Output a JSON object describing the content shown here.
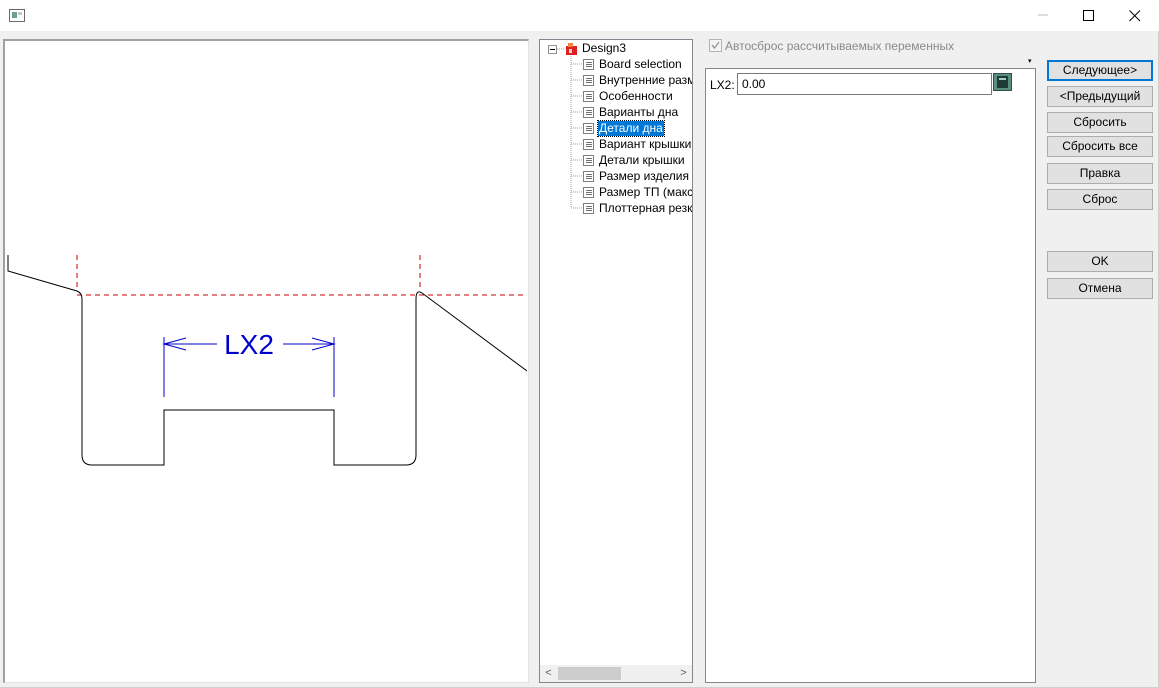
{
  "window": {
    "controls": {
      "minimize_icon": "minimize-icon",
      "maximize_icon": "maximize-icon",
      "close_icon": "close-icon"
    }
  },
  "preview": {
    "dimension_label": "LX2",
    "colors": {
      "outline": "#000000",
      "guide": "#cc0000",
      "dimension": "#0000cc"
    }
  },
  "tree": {
    "root": "Design3",
    "items": [
      {
        "label": "Board selection",
        "selected": false
      },
      {
        "label": "Внутренние разме",
        "selected": false
      },
      {
        "label": "Особенности",
        "selected": false
      },
      {
        "label": "Варианты дна",
        "selected": false
      },
      {
        "label": "Детали дна",
        "selected": true
      },
      {
        "label": "Вариант крышки",
        "selected": false
      },
      {
        "label": "Детали крышки",
        "selected": false
      },
      {
        "label": "Размер изделия",
        "selected": false
      },
      {
        "label": "Размер ТП (макс Г",
        "selected": false
      },
      {
        "label": "Плоттерная резка",
        "selected": false
      }
    ],
    "scroll_left": "<",
    "scroll_right": ">"
  },
  "options": {
    "auto_reset_label": "Автосброс рассчитываемых переменных",
    "auto_reset_checked": true,
    "dropdown_arrow": "▾"
  },
  "variables": [
    {
      "label": "LX2:",
      "value": "0.00"
    }
  ],
  "buttons": {
    "next": "Следующее>",
    "prev": "<Предыдущий",
    "reset": "Сбросить",
    "reset_all": "Сбросить все",
    "edit": "Правка",
    "clear": "Сброс",
    "ok": "OK",
    "cancel": "Отмена"
  },
  "accent_color": "#0078d7"
}
